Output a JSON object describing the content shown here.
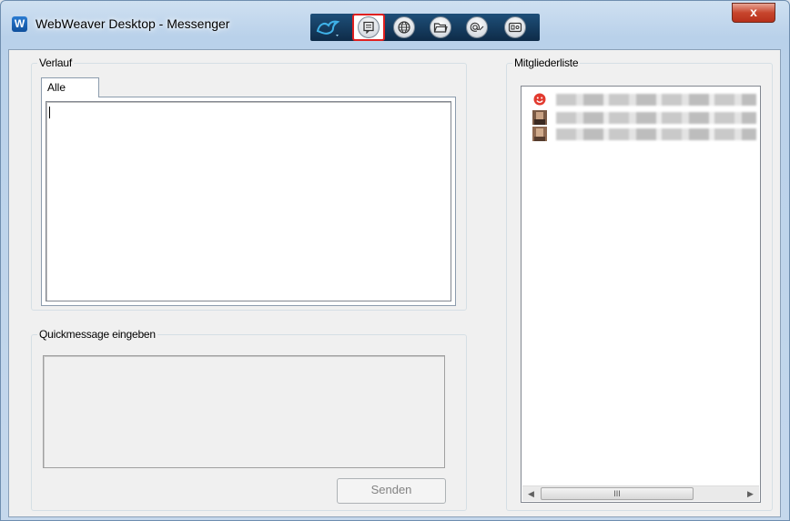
{
  "window": {
    "app_badge": "W",
    "title": "WebWeaver Desktop - Messenger",
    "close_glyph": "x"
  },
  "toolbar": {
    "buttons": [
      {
        "name": "bird-logo-icon",
        "selected": false
      },
      {
        "name": "message-icon",
        "selected": true
      },
      {
        "name": "globe-icon",
        "selected": false
      },
      {
        "name": "folder-icon",
        "selected": false
      },
      {
        "name": "at-mail-icon",
        "selected": false
      },
      {
        "name": "card-icon",
        "selected": false
      }
    ]
  },
  "history": {
    "group_label": "Verlauf",
    "tabs": [
      {
        "label": "Alle"
      }
    ]
  },
  "quickmessage": {
    "group_label": "Quickmessage eingeben",
    "send_label": "Senden"
  },
  "members": {
    "group_label": "Mitgliederliste",
    "items": [
      {
        "avatar": "smiley-icon"
      },
      {
        "avatar": "user-photo-icon"
      },
      {
        "avatar": "user-photo-icon"
      }
    ],
    "scroll_thumb_glyph": "III"
  },
  "colors": {
    "close_button": "#c7452d",
    "selected_outline": "#e02020",
    "toolbar_bg": "#0e2b48"
  }
}
